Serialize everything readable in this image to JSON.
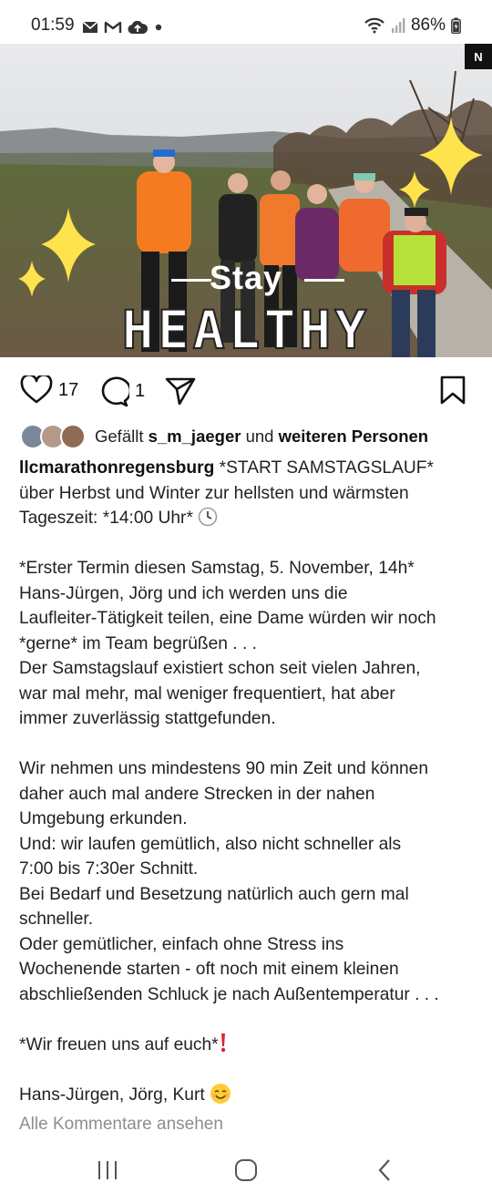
{
  "status_bar": {
    "time": "01:59",
    "battery": "86%",
    "icons": [
      "mail-icon",
      "gmail-icon",
      "cloud-upload-icon",
      "dot-icon",
      "wifi-icon",
      "signal-icon",
      "battery-icon"
    ]
  },
  "post": {
    "reels_badge": "N",
    "overlay": {
      "stay": "Stay",
      "healthy": "HEALTHY"
    },
    "actions": {
      "like_count": "17",
      "comment_count": "1"
    },
    "likes": {
      "prefix": "Gefällt",
      "user": "s_m_jaeger",
      "middle": "und",
      "others": "weiteren Personen"
    },
    "username": "llcmarathonregensburg",
    "caption": {
      "l1": "*START SAMSTAGSLAUF*",
      "l2": "über Herbst und Winter zur hellsten und wärmsten",
      "l3": "Tageszeit: *14:00 Uhr*",
      "l4": "*Erster Termin diesen Samstag, 5. November, 14h*",
      "l5": "Hans-Jürgen, Jörg und ich werden uns die",
      "l6": "Laufleiter-Tätigkeit teilen, eine Dame würden wir noch",
      "l7": "*gerne* im Team begrüßen . . .",
      "l8": "Der Samstagslauf existiert schon seit vielen Jahren,",
      "l9": "war mal mehr, mal weniger frequentiert, hat aber",
      "l10": "immer zuverlässig stattgefunden.",
      "l11": "Wir nehmen uns mindestens 90 min Zeit und können",
      "l12": "daher auch mal andere Strecken in der nahen",
      "l13": "Umgebung erkunden.",
      "l14": "Und: wir laufen gemütlich, also nicht schneller als",
      "l15": "7:00 bis 7:30er Schnitt.",
      "l16": "Bei Bedarf und Besetzung natürlich auch gern mal",
      "l17": "schneller.",
      "l18": "Oder gemütlicher, einfach ohne Stress ins",
      "l19": "Wochenende starten - oft noch mit einem kleinen",
      "l20": "abschließenden Schluck je nach Außentemperatur . . .",
      "l21": "*Wir freuen uns auf euch*",
      "l22": "Hans-Jürgen,  Jörg,  Kurt"
    },
    "view_comments": "Alle Kommentare ansehen"
  },
  "nav_bar": {
    "icons": [
      "recents-icon",
      "home-icon",
      "back-icon"
    ]
  }
}
